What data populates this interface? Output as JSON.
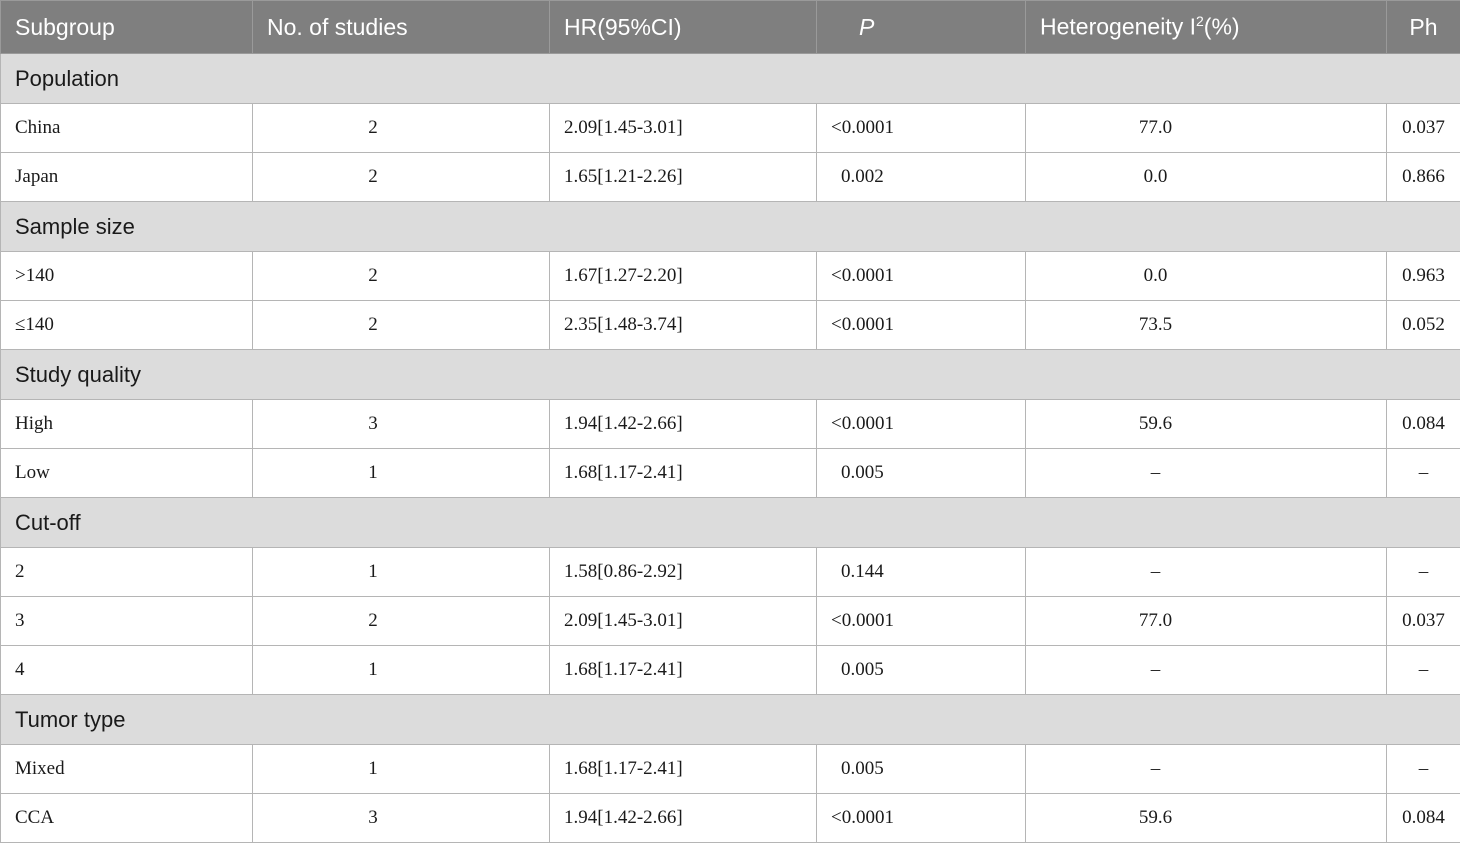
{
  "header": {
    "subgroup": "Subgroup",
    "studies": "No. of studies",
    "hr": "HR(95%CI)",
    "p": "P",
    "het_prefix": "Heterogeneity I",
    "het_sup": "2",
    "het_suffix": "(%)",
    "ph": "Ph"
  },
  "groups": [
    {
      "label": "Population",
      "rows": [
        {
          "subgroup": "China",
          "studies": "2",
          "hr": "2.09[1.45-3.01]",
          "p": "<0.0001",
          "het": "77.0",
          "ph": "0.037"
        },
        {
          "subgroup": "Japan",
          "studies": "2",
          "hr": "1.65[1.21-2.26]",
          "p": "0.002",
          "het": "0.0",
          "ph": "0.866"
        }
      ]
    },
    {
      "label": "Sample size",
      "rows": [
        {
          "subgroup": ">140",
          "studies": "2",
          "hr": "1.67[1.27-2.20]",
          "p": "<0.0001",
          "het": "0.0",
          "ph": "0.963"
        },
        {
          "subgroup": "≤140",
          "studies": "2",
          "hr": "2.35[1.48-3.74]",
          "p": "<0.0001",
          "het": "73.5",
          "ph": "0.052"
        }
      ]
    },
    {
      "label": "Study quality",
      "rows": [
        {
          "subgroup": "High",
          "studies": "3",
          "hr": "1.94[1.42-2.66]",
          "p": "<0.0001",
          "het": "59.6",
          "ph": "0.084"
        },
        {
          "subgroup": "Low",
          "studies": "1",
          "hr": "1.68[1.17-2.41]",
          "p": "0.005",
          "het": "–",
          "ph": "–"
        }
      ]
    },
    {
      "label": "Cut-off",
      "rows": [
        {
          "subgroup": "2",
          "studies": "1",
          "hr": "1.58[0.86-2.92]",
          "p": "0.144",
          "het": "–",
          "ph": "–"
        },
        {
          "subgroup": "3",
          "studies": "2",
          "hr": "2.09[1.45-3.01]",
          "p": "<0.0001",
          "het": "77.0",
          "ph": "0.037"
        },
        {
          "subgroup": "4",
          "studies": "1",
          "hr": "1.68[1.17-2.41]",
          "p": "0.005",
          "het": "–",
          "ph": "–"
        }
      ]
    },
    {
      "label": "Tumor type",
      "rows": [
        {
          "subgroup": "Mixed",
          "studies": "1",
          "hr": "1.68[1.17-2.41]",
          "p": "0.005",
          "het": "–",
          "ph": "–"
        },
        {
          "subgroup": "CCA",
          "studies": "3",
          "hr": "1.94[1.42-2.66]",
          "p": "<0.0001",
          "het": "59.6",
          "ph": "0.084"
        }
      ]
    }
  ]
}
